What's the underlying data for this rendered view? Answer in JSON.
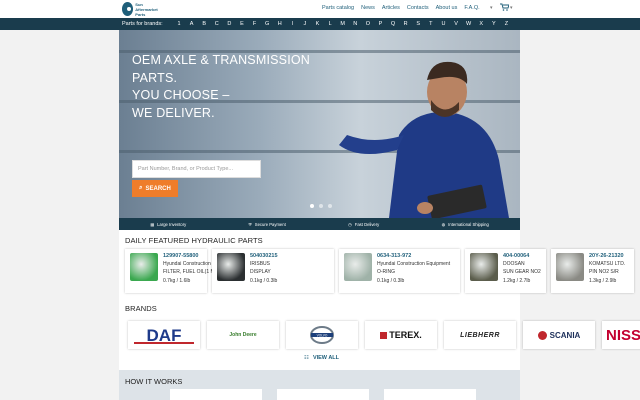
{
  "header": {
    "logo_text": "Sun Aftermarket Parts",
    "nav": [
      "Parts catalog",
      "News",
      "Articles",
      "Contacts",
      "About us",
      "F.A.Q."
    ],
    "lang_label": "",
    "cart_icon": "cart-icon"
  },
  "brandbar": {
    "label": "Parts for brands:",
    "letters": [
      "1",
      "A",
      "B",
      "C",
      "D",
      "E",
      "F",
      "G",
      "H",
      "I",
      "J",
      "K",
      "L",
      "M",
      "N",
      "O",
      "P",
      "Q",
      "R",
      "S",
      "T",
      "U",
      "V",
      "W",
      "X",
      "Y",
      "Z"
    ]
  },
  "hero": {
    "title_lines": [
      "OEM AXLE & TRANSMISSION",
      "PARTS.",
      "YOU CHOOSE –",
      "WE DELIVER."
    ],
    "search_placeholder": "Part Number, Brand, or Product Type...",
    "search_button": "SEARCH",
    "slides": 3,
    "active_slide": 1
  },
  "features": [
    "Large Inventory",
    "Secure Payment",
    "Fast Delivery",
    "International Shipping"
  ],
  "featured": {
    "title": "DAILY FEATURED HYDRAULIC PARTS",
    "items": [
      {
        "code": "129907-55800",
        "line1": "Hyundai Construction Equipment",
        "line2": "FILTER, FUEL OIL(1 MICRON)",
        "line3": "0.7kg / 1.6lb",
        "thumb_color": "#3aa84f"
      },
      {
        "code": "504030215",
        "line1": "IRISBUS",
        "line2": "DISPLAY",
        "line3": "0.1kg / 0.3lb",
        "thumb_color": "#2b2f31"
      },
      {
        "code": "0634-313-972",
        "line1": "Hyundai Construction Equipment",
        "line2": "O-RING",
        "line3": "0.1kg / 0.3lb",
        "thumb_color": "#9fb2a8"
      },
      {
        "code": "404-00064",
        "line1": "DOOSAN",
        "line2": "SUN GEAR NO2",
        "line3": "1.2kg / 2.7lb",
        "thumb_color": "#5b5d4c"
      },
      {
        "code": "20Y-26-21320",
        "line1": "KOMATSU LTD.",
        "line2": "PIN NO2 S/R",
        "line3": "1.3kg / 2.9lb",
        "thumb_color": "#8a8a84"
      }
    ]
  },
  "brands": {
    "title": "BRANDS",
    "items": [
      "DAF",
      "John Deere",
      "VOLVO",
      "TEREX.",
      "LIEBHERR",
      "SCANIA",
      "NISSAN"
    ],
    "view_all": "VIEW ALL"
  },
  "how": {
    "title": "HOW IT WORKS"
  },
  "colors": {
    "accent": "#ef7d2a",
    "dark": "#1a3c4d",
    "link": "#1f5f7a"
  }
}
